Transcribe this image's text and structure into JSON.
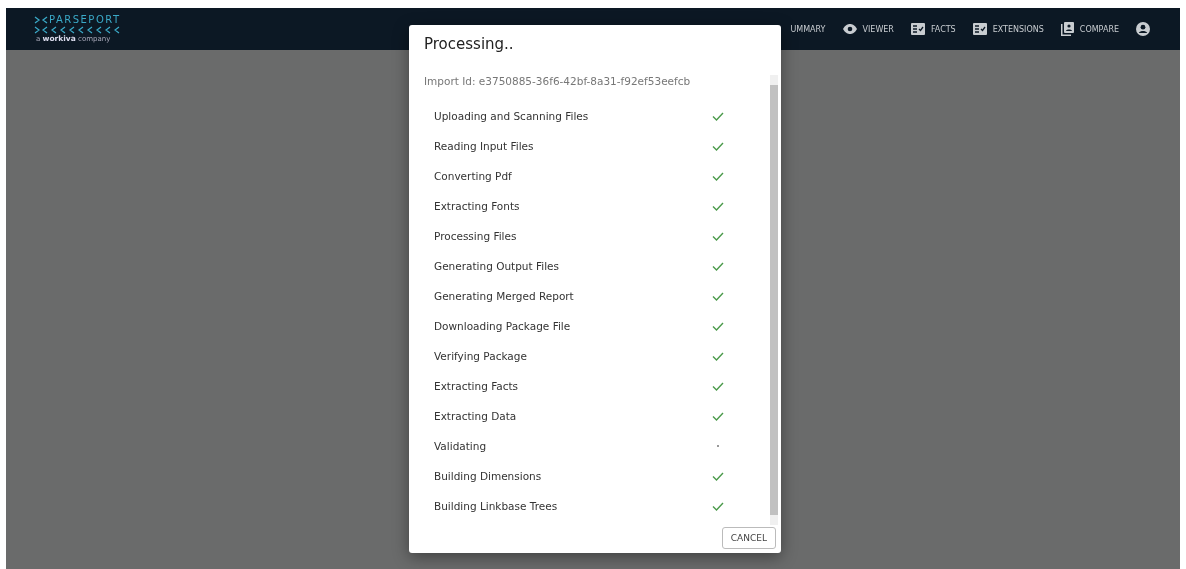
{
  "header": {
    "logo": {
      "name": "PARSEPORT",
      "tagline_prefix": "a",
      "tagline_brand": "workiva",
      "tagline_suffix": "company"
    },
    "nav": [
      {
        "label": "UMMARY",
        "kind": "plain"
      },
      {
        "label": "VIEWER",
        "kind": "eye"
      },
      {
        "label": "FACTS",
        "kind": "list"
      },
      {
        "label": "EXTENSIONS",
        "kind": "list"
      },
      {
        "label": "COMPARE",
        "kind": "doc"
      }
    ]
  },
  "dialog": {
    "title": "Processing..",
    "import_id": "Import Id: e3750885-36f6-42bf-8a31-f92ef53eefcb",
    "steps": [
      {
        "label": "Uploading and Scanning Files",
        "done": true
      },
      {
        "label": "Reading Input Files",
        "done": true
      },
      {
        "label": "Converting Pdf",
        "done": true
      },
      {
        "label": "Extracting Fonts",
        "done": true
      },
      {
        "label": "Processing Files",
        "done": true
      },
      {
        "label": "Generating Output Files",
        "done": true
      },
      {
        "label": "Generating Merged Report",
        "done": true
      },
      {
        "label": "Downloading Package File",
        "done": true
      },
      {
        "label": "Verifying Package",
        "done": true
      },
      {
        "label": "Extracting Facts",
        "done": true
      },
      {
        "label": "Extracting Data",
        "done": true
      },
      {
        "label": "Validating",
        "done": false
      },
      {
        "label": "Building Dimensions",
        "done": true
      },
      {
        "label": "Building Linkbase Trees",
        "done": true
      }
    ],
    "buttons": [
      "CANCEL"
    ]
  }
}
